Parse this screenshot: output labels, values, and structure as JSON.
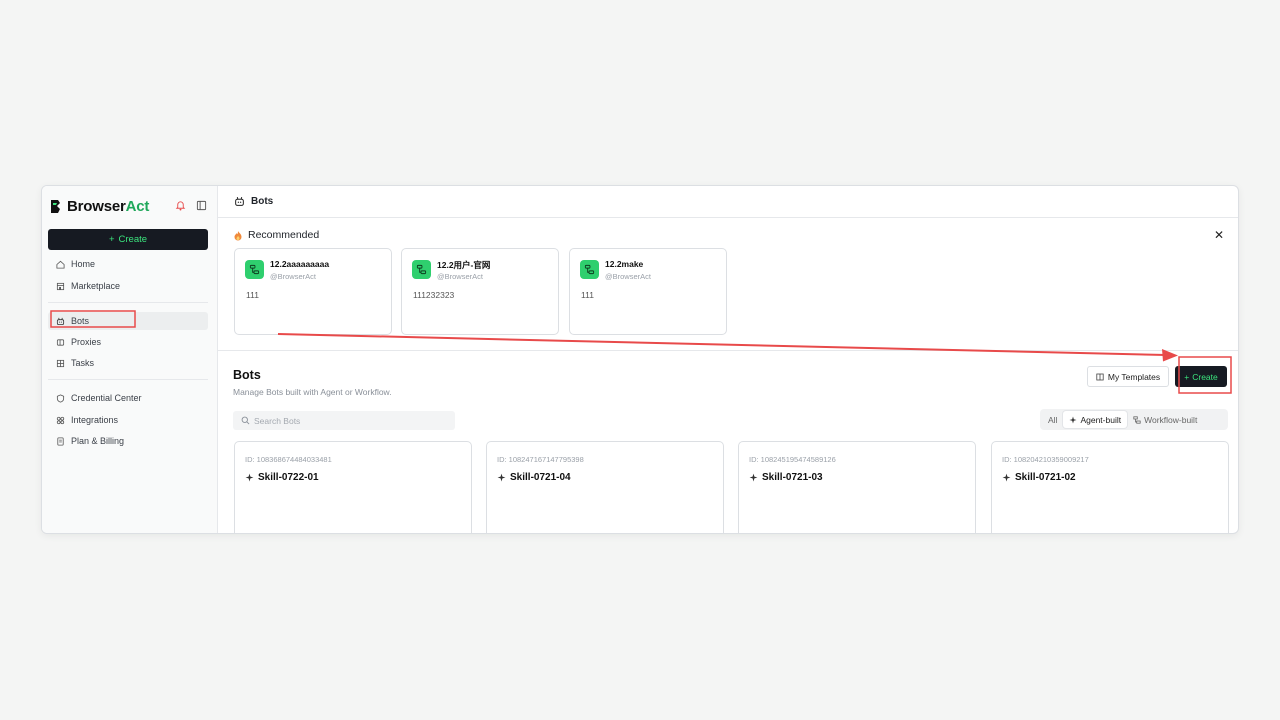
{
  "brand": {
    "name_main": "Browser",
    "name_accent": "Act"
  },
  "sidebar": {
    "create_label": "Create",
    "items": [
      {
        "label": "Home",
        "icon": "home-icon"
      },
      {
        "label": "Marketplace",
        "icon": "store-icon"
      },
      {
        "label": "Bots",
        "icon": "bot-icon"
      },
      {
        "label": "Proxies",
        "icon": "proxy-icon"
      },
      {
        "label": "Tasks",
        "icon": "tasks-icon"
      },
      {
        "label": "Credential Center",
        "icon": "shield-icon"
      },
      {
        "label": "Integrations",
        "icon": "integrations-icon"
      },
      {
        "label": "Plan & Billing",
        "icon": "billing-icon"
      }
    ]
  },
  "tab": {
    "label": "Bots"
  },
  "recommended": {
    "title": "Recommended",
    "cards": [
      {
        "title": "12.2aaaaaaaaa",
        "author": "@BrowserAct",
        "desc": "111"
      },
      {
        "title": "12.2用户-官网",
        "author": "@BrowserAct",
        "desc": "111232323"
      },
      {
        "title": "12.2make",
        "author": "@BrowserAct",
        "desc": "111"
      }
    ]
  },
  "bots": {
    "title": "Bots",
    "subtitle": "Manage Bots built with Agent or Workflow.",
    "templates_label": "My Templates",
    "create_label": "Create",
    "search_placeholder": "Search Bots",
    "filters": [
      "All",
      "Agent-built",
      "Workflow-built"
    ],
    "active_filter": "Agent-built",
    "cards": [
      {
        "id": "ID: 108368674484033481",
        "name": "Skill-0722-01"
      },
      {
        "id": "ID: 108247167147795398",
        "name": "Skill-0721-04"
      },
      {
        "id": "ID: 108245195474589126",
        "name": "Skill-0721-03"
      },
      {
        "id": "ID: 108204210359009217",
        "name": "Skill-0721-02"
      }
    ]
  },
  "colors": {
    "accent": "#3be47d",
    "brand_green": "#1fa75a",
    "dark": "#161a22",
    "annotation_red": "#e84a4a"
  }
}
